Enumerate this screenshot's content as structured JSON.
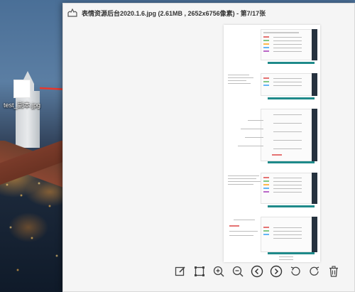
{
  "desktop": {
    "icon_label": "test_副本.jpg"
  },
  "viewer": {
    "title": "表情资源后台2020.1.6.jpg (2.61MB , 2652x6756像素) - 第7/17张",
    "toolbar": [
      {
        "icon": "edit-icon"
      },
      {
        "icon": "crop-icon"
      },
      {
        "icon": "zoom-in-icon"
      },
      {
        "icon": "zoom-out-icon"
      },
      {
        "icon": "previous-icon"
      },
      {
        "icon": "next-icon"
      },
      {
        "icon": "rotate-left-icon"
      },
      {
        "icon": "rotate-right-icon"
      },
      {
        "icon": "delete-icon"
      }
    ]
  },
  "colors": {
    "arrow": "#e8372c",
    "accent_teal": "#1f8a8a",
    "dark_panel": "#26323f",
    "tag_colors": [
      "#e57373",
      "#81c784",
      "#ffb74d",
      "#64b5f6",
      "#ba68c8"
    ]
  }
}
